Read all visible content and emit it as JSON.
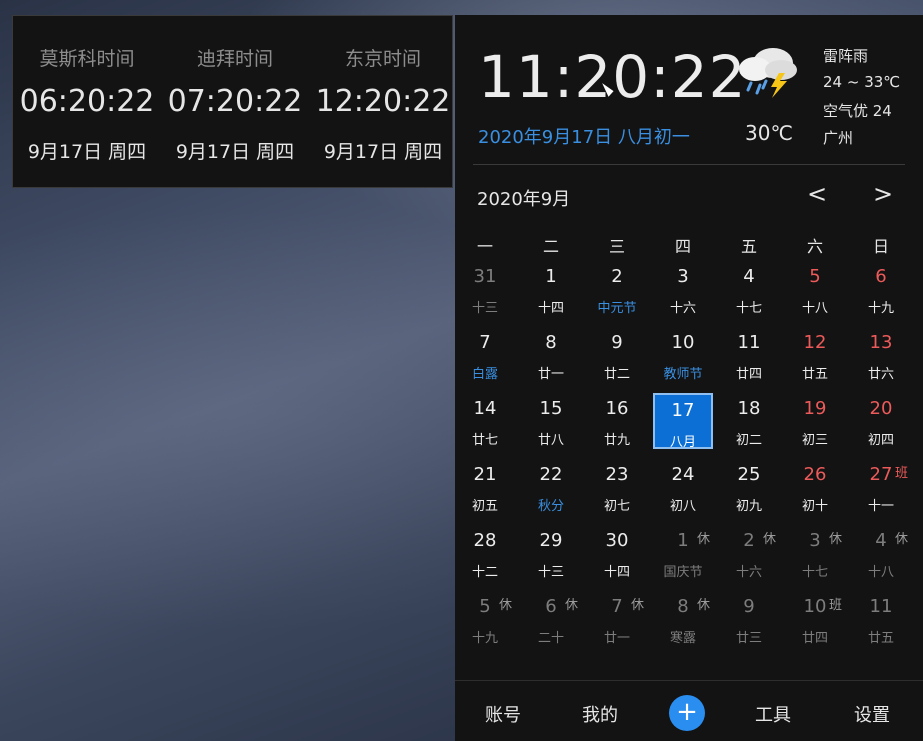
{
  "world_clock": [
    {
      "name": "莫斯科时间",
      "time": "06:20:22",
      "date": "9月17日 周四"
    },
    {
      "name": "迪拜时间",
      "time": "07:20:22",
      "date": "9月17日 周四"
    },
    {
      "name": "东京时间",
      "time": "12:20:22",
      "date": "9月17日 周四"
    }
  ],
  "clock": {
    "time": "11:20:22",
    "date": "2020年9月17日 八月初一"
  },
  "weather": {
    "icon": "thunderstorm-rain-icon",
    "temp": "30℃",
    "condition": "雷阵雨",
    "range": "24 ~ 33℃",
    "aqi": "空气优 24",
    "city": "广州"
  },
  "calendar": {
    "title": "2020年9月",
    "prev": "<",
    "next": ">",
    "weekdays": [
      "一",
      "二",
      "三",
      "四",
      "五",
      "六",
      "日"
    ],
    "days": [
      {
        "n": "31",
        "s": "十三",
        "o": true
      },
      {
        "n": "1",
        "s": "十四"
      },
      {
        "n": "2",
        "s": "中元节",
        "f": true
      },
      {
        "n": "3",
        "s": "十六"
      },
      {
        "n": "4",
        "s": "十七"
      },
      {
        "n": "5",
        "s": "十八",
        "w": true
      },
      {
        "n": "6",
        "s": "十九",
        "w": true
      },
      {
        "n": "7",
        "s": "白露",
        "f": true
      },
      {
        "n": "8",
        "s": "廿一"
      },
      {
        "n": "9",
        "s": "廿二"
      },
      {
        "n": "10",
        "s": "教师节",
        "f": true
      },
      {
        "n": "11",
        "s": "廿四"
      },
      {
        "n": "12",
        "s": "廿五",
        "w": true
      },
      {
        "n": "13",
        "s": "廿六",
        "w": true
      },
      {
        "n": "14",
        "s": "廿七"
      },
      {
        "n": "15",
        "s": "廿八"
      },
      {
        "n": "16",
        "s": "廿九"
      },
      {
        "n": "17",
        "s": "八月",
        "t": true
      },
      {
        "n": "18",
        "s": "初二"
      },
      {
        "n": "19",
        "s": "初三",
        "w": true
      },
      {
        "n": "20",
        "s": "初四",
        "w": true
      },
      {
        "n": "21",
        "s": "初五"
      },
      {
        "n": "22",
        "s": "秋分",
        "f": true
      },
      {
        "n": "23",
        "s": "初七"
      },
      {
        "n": "24",
        "s": "初八"
      },
      {
        "n": "25",
        "s": "初九"
      },
      {
        "n": "26",
        "s": "初十",
        "w": true
      },
      {
        "n": "27",
        "s": "十一",
        "w": true,
        "tag": "班",
        "work": true
      },
      {
        "n": "28",
        "s": "十二"
      },
      {
        "n": "29",
        "s": "十三"
      },
      {
        "n": "30",
        "s": "十四"
      },
      {
        "n": "1",
        "s": "国庆节",
        "o": true,
        "tag": "休"
      },
      {
        "n": "2",
        "s": "十六",
        "o": true,
        "tag": "休"
      },
      {
        "n": "3",
        "s": "十七",
        "o": true,
        "tag": "休"
      },
      {
        "n": "4",
        "s": "十八",
        "o": true,
        "tag": "休"
      },
      {
        "n": "5",
        "s": "十九",
        "o": true,
        "tag": "休"
      },
      {
        "n": "6",
        "s": "二十",
        "o": true,
        "tag": "休"
      },
      {
        "n": "7",
        "s": "廿一",
        "o": true,
        "tag": "休"
      },
      {
        "n": "8",
        "s": "寒露",
        "o": true,
        "tag": "休"
      },
      {
        "n": "9",
        "s": "廿三",
        "o": true
      },
      {
        "n": "10",
        "s": "廿四",
        "o": true,
        "tag": "班",
        "work": true
      },
      {
        "n": "11",
        "s": "廿五",
        "o": true
      }
    ]
  },
  "bottom_bar": {
    "account": "账号",
    "mine": "我的",
    "add": "+",
    "tools": "工具",
    "settings": "设置"
  },
  "colors": {
    "accent": "#2a8ef0",
    "weekend": "#ec5a5a",
    "festival": "#3a8fe0",
    "today_bg": "#0b6fd6"
  }
}
